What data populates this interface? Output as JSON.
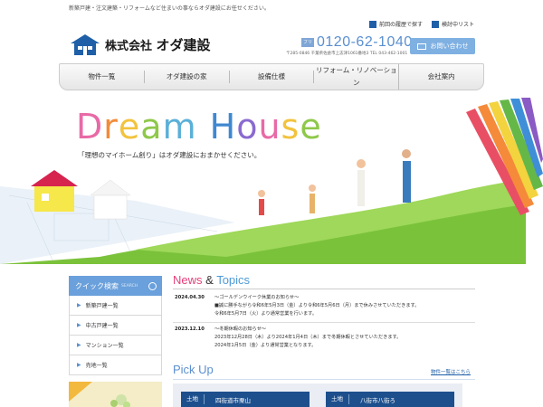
{
  "header": {
    "tagline": "新築戸建・注文建築・リフォームなど住まいの事ならオダ建設にお任せください。",
    "company_prefix": "株式会社",
    "company_name": "オダ建設",
    "top_links": [
      {
        "label": "前回の履歴で探す",
        "icon": "history-icon"
      },
      {
        "label": "検討中リスト",
        "icon": "list-icon"
      }
    ],
    "tel_badge": "フリー",
    "tel": "0120-62-1040",
    "address": "〒285-0846 千葉県佐倉市上志津1061番地3 TEL 043-462-1001",
    "contact_label": "お問い合わせ"
  },
  "nav": {
    "items": [
      "物件一覧",
      "オダ建設の家",
      "設備仕様",
      "リフォーム・リノベーション",
      "会社案内"
    ]
  },
  "hero": {
    "title_letters": [
      "D",
      "r",
      "e",
      "a",
      "m",
      " ",
      "H",
      "o",
      "u",
      "s",
      "e"
    ],
    "subtitle": "「理想のマイホーム創り」はオダ建設におまかせください。"
  },
  "quick_search": {
    "title": "クイック検索",
    "title_en": "SEARCH",
    "items": [
      "新築戸建一覧",
      "中古戸建一覧",
      "マンション一覧",
      "売地一覧"
    ]
  },
  "news": {
    "title_a": "News",
    "title_amp": "&",
    "title_b": "Topics",
    "entries": [
      {
        "date": "2024.04.30",
        "title": "～ゴールデンウイーク休業のお知らせ～",
        "lines": [
          "■誠に勝手ながら令和6年5月3日（金）より令和6年5月6日（月）まで休みさせていただきます。",
          "令和6年5月7日（火）より通常営業を行います。"
        ]
      },
      {
        "date": "2023.12.10",
        "title": "～冬期休暇のお知らせ～",
        "lines": [
          "2023年12月28日（木）より2024年1月4日（木）まで冬期休暇とさせていただきます。",
          "2024年1月5日（金）より通常営業となります。"
        ]
      }
    ]
  },
  "pickup": {
    "title": "Pick Up",
    "link": "物件一覧はこちら",
    "cards": [
      {
        "tag": "土地",
        "place": "四街道市栗山"
      },
      {
        "tag": "土地",
        "place": "八街市八街ろ"
      }
    ]
  },
  "colors": {
    "accent_blue": "#5b8fd0",
    "nav_bg": "#eeeeee",
    "news_pink": "#e5407a",
    "pickup_band": "#1d4f8d"
  }
}
